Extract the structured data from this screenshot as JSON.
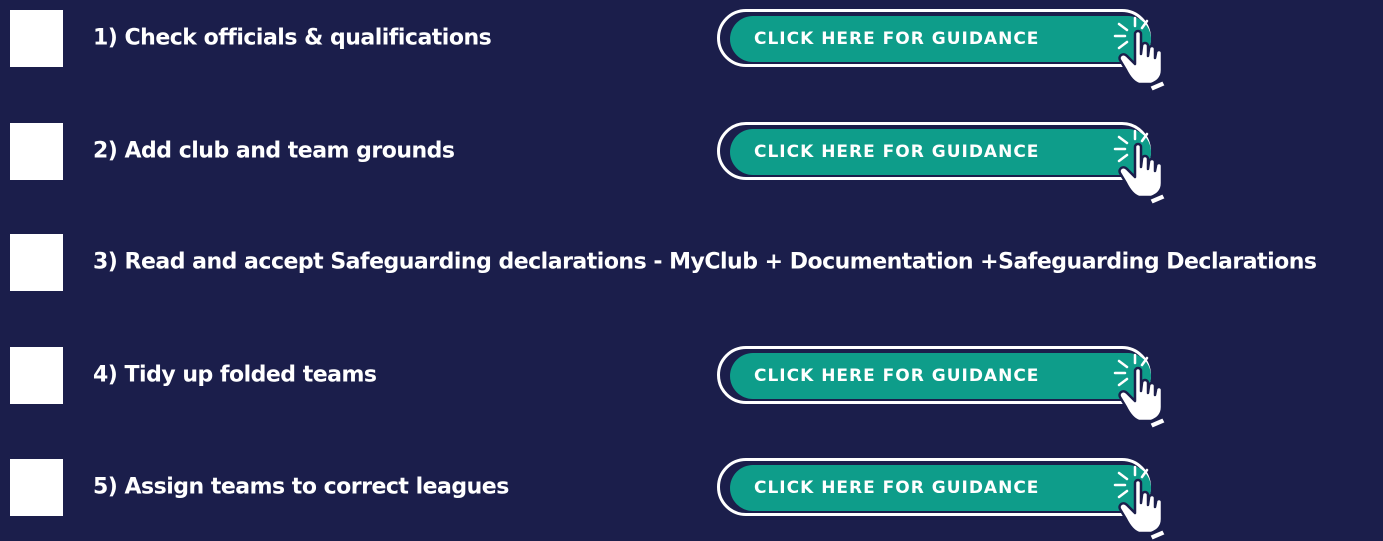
{
  "page": {
    "background": "#1b1e4b",
    "button_color": "#0e9d8a"
  },
  "tasks": [
    {
      "label": "1) Check officials & qualifications",
      "has_guidance": true,
      "checked": false
    },
    {
      "label": "2) Add club and team grounds",
      "has_guidance": true,
      "checked": false
    },
    {
      "label": "3) Read and accept Safeguarding declarations - MyClub + Documentation +Safeguarding Declarations",
      "has_guidance": false,
      "checked": false
    },
    {
      "label": "4) Tidy up folded teams",
      "has_guidance": true,
      "checked": false
    },
    {
      "label": "5) Assign teams to correct leagues",
      "has_guidance": true,
      "checked": false
    }
  ],
  "guidance": {
    "label": "CLICK HERE FOR GUIDANCE",
    "icon": "pointing-hand-click-icon"
  }
}
